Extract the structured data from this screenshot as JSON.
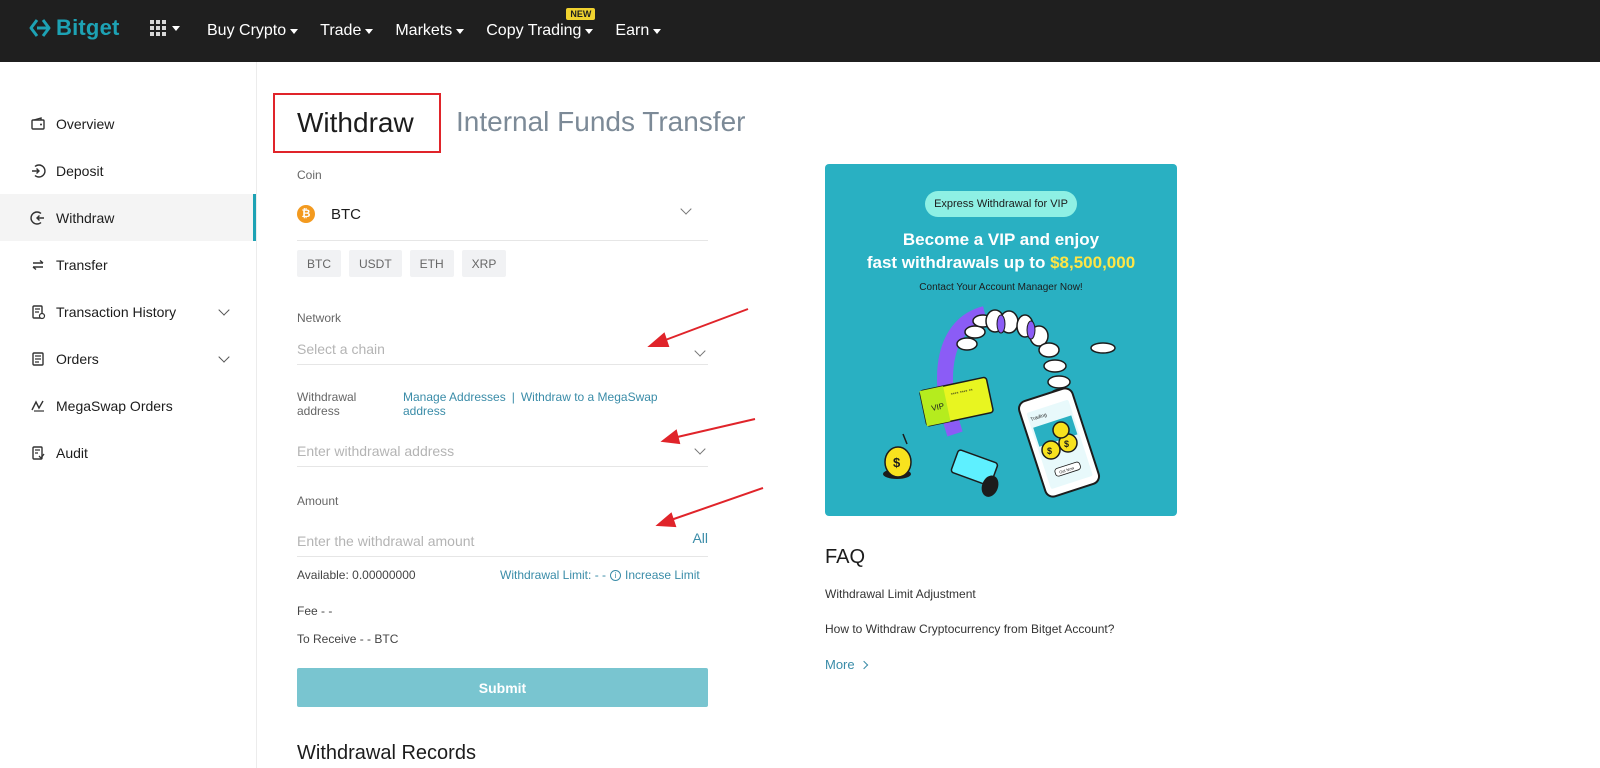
{
  "brand": {
    "name": "Bitget",
    "accent": "#1da2b4",
    "topbar_bg": "#1f1f1f"
  },
  "nav": {
    "items": [
      {
        "label": "Buy Crypto"
      },
      {
        "label": "Trade"
      },
      {
        "label": "Markets"
      },
      {
        "label": "Copy Trading",
        "badge": "NEW"
      },
      {
        "label": "Earn"
      }
    ]
  },
  "sidebar": {
    "items": [
      {
        "label": "Overview",
        "icon": "wallet-icon"
      },
      {
        "label": "Deposit",
        "icon": "deposit-icon"
      },
      {
        "label": "Withdraw",
        "icon": "withdraw-icon",
        "active": true
      },
      {
        "label": "Transfer",
        "icon": "transfer-icon"
      },
      {
        "label": "Transaction History",
        "icon": "history-icon",
        "expandable": true
      },
      {
        "label": "Orders",
        "icon": "orders-icon",
        "expandable": true
      },
      {
        "label": "MegaSwap Orders",
        "icon": "megaswap-icon"
      },
      {
        "label": "Audit",
        "icon": "audit-icon"
      }
    ]
  },
  "tabs": {
    "withdraw": "Withdraw",
    "internal": "Internal Funds Transfer"
  },
  "form": {
    "coin_label": "Coin",
    "coin_value": "BTC",
    "coin_icon_symbol": "₿",
    "chips": [
      "BTC",
      "USDT",
      "ETH",
      "XRP"
    ],
    "network_label": "Network",
    "network_placeholder": "Select a chain",
    "address_label": "Withdrawal address",
    "manage_addresses": "Manage Addresses",
    "separator": "|",
    "megaswap_link": "Withdraw to a MegaSwap address",
    "address_placeholder": "Enter withdrawal address",
    "amount_label": "Amount",
    "amount_placeholder": "Enter the withdrawal amount",
    "all_label": "All",
    "available": "Available: 0.00000000",
    "withdrawal_limit": "Withdrawal Limit: - -",
    "increase_limit": "Increase Limit",
    "fee": "Fee - -",
    "to_receive": "To Receive - - BTC",
    "submit": "Submit"
  },
  "records_title": "Withdrawal Records",
  "banner": {
    "pill": "Express Withdrawal for VIP",
    "line1": "Become a VIP and enjoy",
    "line2_prefix": "fast withdrawals up to ",
    "line2_amount": "$8,500,000",
    "subtitle": "Contact Your Account Manager Now!",
    "card_label": "VIP",
    "card_number": "**** **** **",
    "phone_label": "Trading",
    "phone_button": "Get Now"
  },
  "faq": {
    "title": "FAQ",
    "items": [
      "Withdrawal Limit Adjustment",
      "How to Withdraw Cryptocurrency from Bitget Account?"
    ],
    "more": "More"
  }
}
